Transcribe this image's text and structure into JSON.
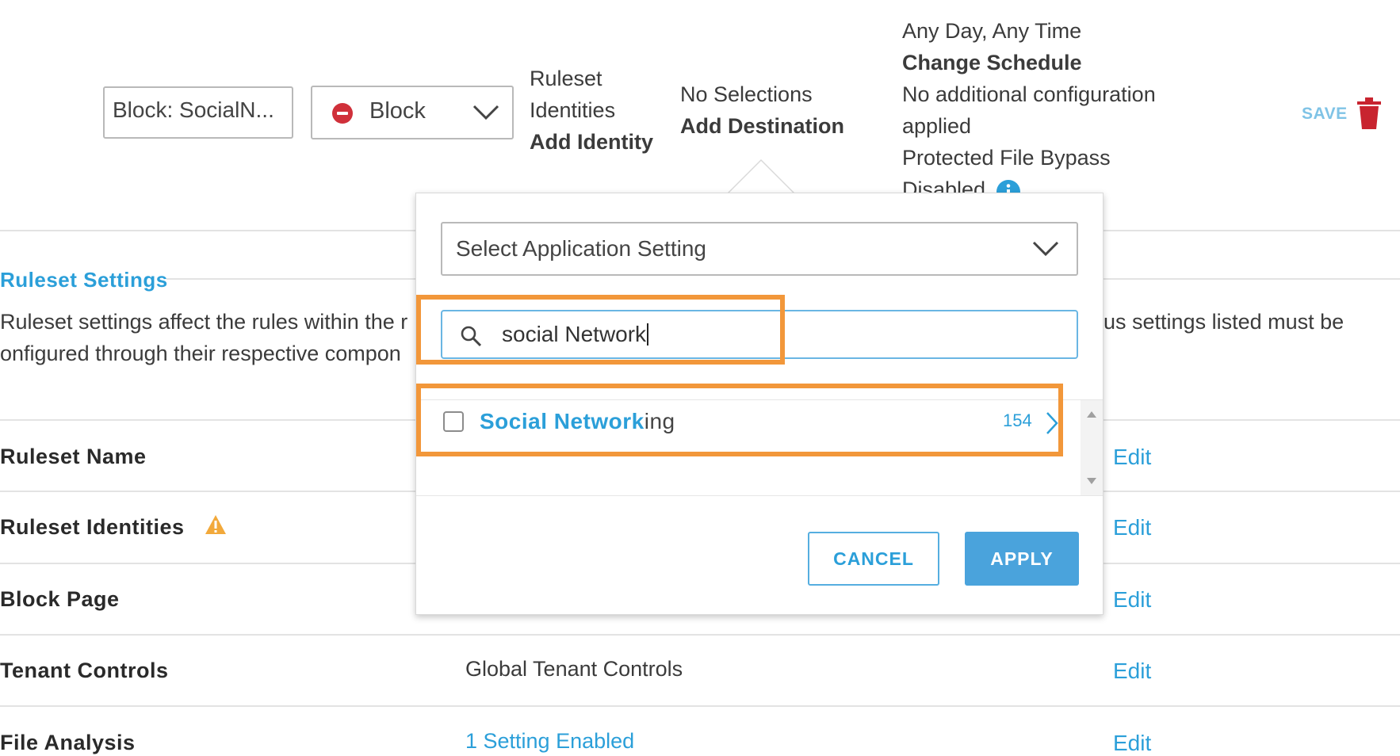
{
  "top_bar": {
    "rule_name_value": "Block: SocialN...",
    "action_value": "Block",
    "identities": {
      "line1": "Ruleset",
      "line2": "Identities",
      "link": "Add Identity"
    },
    "destinations": {
      "status": "No Selections",
      "link": "Add Destination"
    },
    "schedule": {
      "value": "Any Day, Any Time",
      "link": "Change Schedule",
      "config_line1": "No additional configuration",
      "config_line2": "applied",
      "bypass_line1": "Protected File Bypass",
      "bypass_line2": "Disabled"
    },
    "save_label": "SAVE",
    "icons": {
      "delete": "trash-icon",
      "info": "info-icon",
      "action": "block-icon"
    }
  },
  "ruleset_settings": {
    "title": "Ruleset Settings",
    "desc_left_1": "Ruleset settings affect the rules within the r",
    "desc_left_2": "onfigured through their respective compon",
    "desc_right_1": "us settings listed must be",
    "rows": [
      {
        "label": "Ruleset Name",
        "value": "",
        "edit": "Edit"
      },
      {
        "label": "Ruleset Identities",
        "value": "",
        "edit": "Edit"
      },
      {
        "label": "Block Page",
        "value": "",
        "edit": "Edit"
      },
      {
        "label": "Tenant Controls",
        "value": "Global Tenant Controls",
        "edit": "Edit"
      },
      {
        "label": "File Analysis",
        "value": "1 Setting Enabled",
        "edit": "Edit"
      }
    ]
  },
  "popover": {
    "select_label": "Select Application Setting",
    "search_value": "social Network",
    "results": [
      {
        "match": "Social Network",
        "rest": "ing",
        "count": "154"
      }
    ],
    "cancel_label": "CANCEL",
    "apply_label": "APPLY"
  },
  "colors": {
    "link": "#2b9fd9",
    "highlight": "#f2973a",
    "block_red": "#d0303a",
    "apply_bg": "#4aa3dc"
  }
}
